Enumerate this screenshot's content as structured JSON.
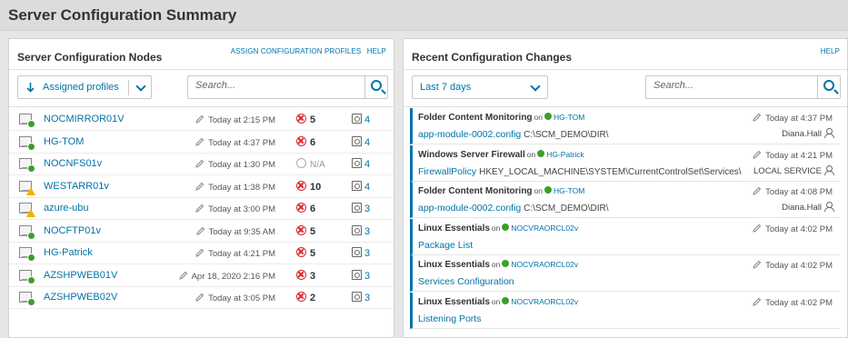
{
  "page": {
    "title": "Server Configuration Summary"
  },
  "colors": {
    "accent": "#0073a8",
    "ok": "#3aa02a",
    "error": "#d82a2a",
    "warning": "#f0b400"
  },
  "nodes_panel": {
    "title": "Server Configuration Nodes",
    "assign_link": "ASSIGN CONFIGURATION PROFILES",
    "help_link": "HELP",
    "sort_dropdown": {
      "label": "Assigned profiles",
      "arrow_icon": "sort-arrow-down-icon"
    },
    "search": {
      "placeholder": "Search..."
    },
    "rows": [
      {
        "name": "NOCMIRROR01V",
        "status": "ok",
        "time": "Today at 2:15 PM",
        "changes": "5",
        "profiles": "4"
      },
      {
        "name": "HG-TOM",
        "status": "ok",
        "time": "Today at 4:37 PM",
        "changes": "6",
        "profiles": "4"
      },
      {
        "name": "NOCNFS01v",
        "status": "ok",
        "time": "Today at 1:30 PM",
        "changes": "N/A",
        "changes_na": true,
        "profiles": "4"
      },
      {
        "name": "WESTARR01v",
        "status": "warning",
        "time": "Today at 1:38 PM",
        "changes": "10",
        "profiles": "4"
      },
      {
        "name": "azure-ubu",
        "status": "warning",
        "time": "Today at 3:00 PM",
        "changes": "6",
        "profiles": "3"
      },
      {
        "name": "NOCFTP01v",
        "status": "ok",
        "time": "Today at 9:35 AM",
        "changes": "5",
        "profiles": "3"
      },
      {
        "name": "HG-Patrick",
        "status": "ok",
        "time": "Today at 4:21 PM",
        "changes": "5",
        "profiles": "3"
      },
      {
        "name": "AZSHPWEB01V",
        "status": "ok",
        "time": "Apr 18, 2020 2:16 PM",
        "changes": "3",
        "profiles": "3"
      },
      {
        "name": "AZSHPWEB02V",
        "status": "ok",
        "time": "Today at 3:05 PM",
        "changes": "2",
        "profiles": "3"
      }
    ]
  },
  "changes_panel": {
    "title": "Recent Configuration Changes",
    "help_link": "HELP",
    "period_dropdown": {
      "label": "Last 7 days"
    },
    "search": {
      "placeholder": "Search..."
    },
    "on_text": "on",
    "items": [
      {
        "profile": "Folder Content Monitoring",
        "node": "HG-TOM",
        "element": "app-module-0002.config",
        "path": "C:\\SCM_DEMO\\DIR\\",
        "time": "Today at 4:37 PM",
        "user": "Diana.Hall"
      },
      {
        "profile": "Windows Server Firewall",
        "node": "HG-Patrick",
        "element": "FirewallPolicy",
        "path": "HKEY_LOCAL_MACHINE\\SYSTEM\\CurrentControlSet\\Services\\",
        "time": "Today at 4:21 PM",
        "user": "LOCAL SERVICE"
      },
      {
        "profile": "Folder Content Monitoring",
        "node": "HG-TOM",
        "element": "app-module-0002.config",
        "path": "C:\\SCM_DEMO\\DIR\\",
        "time": "Today at 4:08 PM",
        "user": "Diana.Hall"
      },
      {
        "profile": "Linux Essentials",
        "node": "NOCVRAORCL02v",
        "element": "Package List",
        "path": "",
        "time": "Today at 4:02 PM",
        "user": ""
      },
      {
        "profile": "Linux Essentials",
        "node": "NOCVRAORCL02v",
        "element": "Services Configuration",
        "path": "",
        "time": "Today at 4:02 PM",
        "user": ""
      },
      {
        "profile": "Linux Essentials",
        "node": "NOCVRAORCL02v",
        "element": "Listening Ports",
        "path": "",
        "time": "Today at 4:02 PM",
        "user": ""
      }
    ]
  }
}
